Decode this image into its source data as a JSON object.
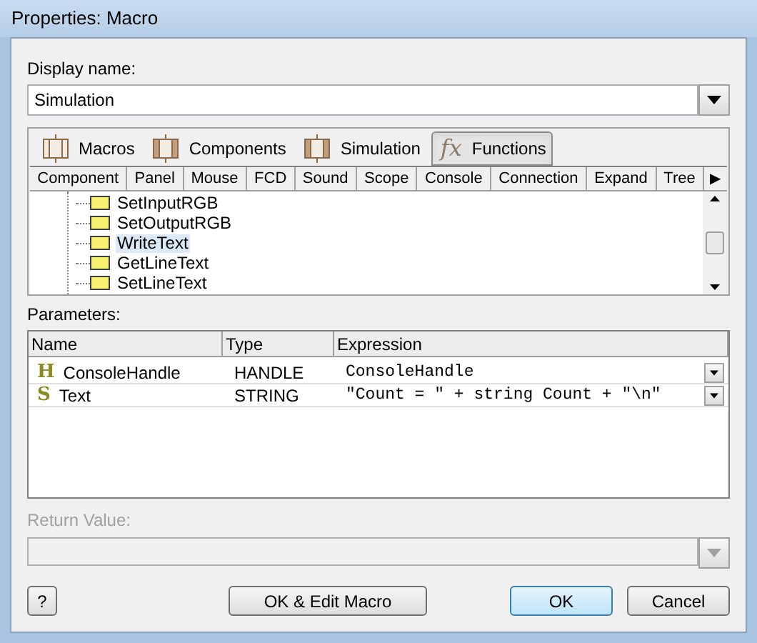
{
  "window": {
    "title": "Properties: Macro"
  },
  "display_name": {
    "label": "Display name:",
    "value": "Simulation"
  },
  "tabs": [
    {
      "label": "Macros",
      "kind": "plain",
      "selected": false
    },
    {
      "label": "Components",
      "kind": "hatched",
      "selected": false
    },
    {
      "label": "Simulation",
      "kind": "hatched",
      "selected": false
    },
    {
      "label": "Functions",
      "kind": "fx",
      "icon": "fx",
      "selected": true
    }
  ],
  "subtabs": [
    "Component",
    "Panel",
    "Mouse",
    "FCD",
    "Sound",
    "Scope",
    "Console",
    "Connection",
    "Expand",
    "Tree"
  ],
  "subtab_more": "▶",
  "tree": [
    {
      "label": "SetInputRGB",
      "selected": false
    },
    {
      "label": "SetOutputRGB",
      "selected": false
    },
    {
      "label": "WriteText",
      "selected": true
    },
    {
      "label": "GetLineText",
      "selected": false
    },
    {
      "label": "SetLineText",
      "selected": false
    }
  ],
  "parameters": {
    "label": "Parameters:",
    "columns": [
      "Name",
      "Type",
      "Expression"
    ],
    "rows": [
      {
        "icon": "H",
        "name": "ConsoleHandle",
        "type": "HANDLE",
        "expression": "ConsoleHandle"
      },
      {
        "icon": "S",
        "name": "Text",
        "type": "STRING",
        "expression": "\"Count = \" + string Count + \"\\n\""
      }
    ]
  },
  "return_value": {
    "label": "Return Value:",
    "disabled": true
  },
  "buttons": [
    {
      "label": "?",
      "kind": "help",
      "default": false
    },
    {
      "label": "OK & Edit Macro",
      "kind": "action",
      "default": false
    },
    {
      "label": "OK",
      "kind": "confirm",
      "default": true
    },
    {
      "label": "Cancel",
      "kind": "confirm",
      "default": false
    }
  ]
}
